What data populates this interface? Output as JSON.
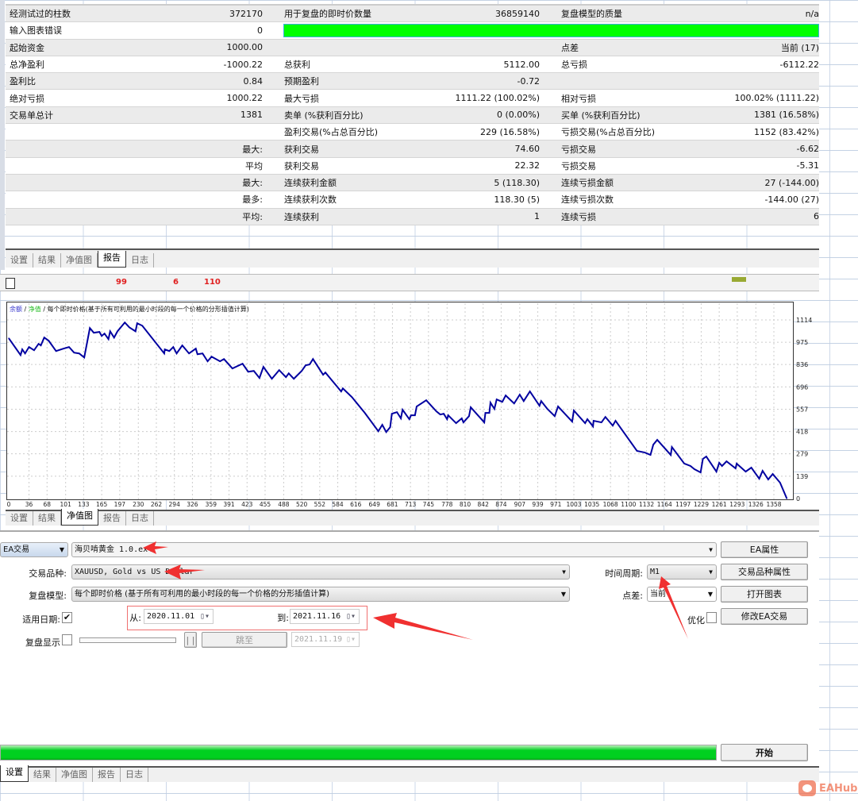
{
  "report": {
    "rows": [
      [
        "经测试过的柱数",
        "372170",
        "用于复盘的即时价数量",
        "36859140",
        "复盘模型的质量",
        "n/a"
      ],
      [
        "输入图表错误",
        "0",
        "",
        "",
        "",
        ""
      ],
      [
        "起始资金",
        "1000.00",
        "",
        "",
        "点差",
        "当前 (17)"
      ],
      [
        "总净盈利",
        "-1000.22",
        "总获利",
        "5112.00",
        "总亏损",
        "-6112.22"
      ],
      [
        "盈利比",
        "0.84",
        "预期盈利",
        "-0.72",
        "",
        ""
      ],
      [
        "绝对亏损",
        "1000.22",
        "最大亏损",
        "1111.22 (100.02%)",
        "相对亏损",
        "100.02% (1111.22)"
      ],
      [
        "交易单总计",
        "1381",
        "卖单 (%获利百分比)",
        "0 (0.00%)",
        "买单 (%获利百分比)",
        "1381 (16.58%)"
      ],
      [
        "",
        "",
        "盈利交易(%占总百分比)",
        "229 (16.58%)",
        "亏损交易(%占总百分比)",
        "1152 (83.42%)"
      ],
      [
        "",
        "最大:",
        "获利交易",
        "74.60",
        "亏损交易",
        "-6.62"
      ],
      [
        "",
        "平均",
        "获利交易",
        "22.32",
        "亏损交易",
        "-5.31"
      ],
      [
        "",
        "最大:",
        "连续获利金额",
        "5 (118.30)",
        "连续亏损金额",
        "27 (-144.00)"
      ],
      [
        "",
        "最多:",
        "连续获利次数",
        "118.30 (5)",
        "连续亏损次数",
        "-144.00 (27)"
      ],
      [
        "",
        "平均:",
        "连续获利",
        "1",
        "连续亏损",
        "6"
      ]
    ],
    "quality_bar_color": "#00ff00"
  },
  "tabs_top": {
    "items": [
      "设置",
      "结果",
      "净值图",
      "报告",
      "日志"
    ],
    "active": "报告"
  },
  "strip": {
    "badges": [
      "99",
      "6",
      "110"
    ]
  },
  "chart_data": {
    "type": "line",
    "legend": {
      "balance": "余额",
      "equity": "净值",
      "sep": "/"
    },
    "title": "每个即时价格(基于所有可利用的最小时段的每一个价格的分形插值计算)",
    "line_color": "#0000a0",
    "balance_color": "#3333cc",
    "equity_color": "#22bb22",
    "grid": true,
    "ylim": [
      0,
      1114
    ],
    "xlim": [
      0,
      1395
    ],
    "yticks": [
      1114,
      975,
      836,
      696,
      557,
      418,
      279,
      139,
      0
    ],
    "xticks": [
      0,
      36,
      68,
      101,
      133,
      165,
      197,
      230,
      262,
      294,
      326,
      359,
      391,
      423,
      455,
      488,
      520,
      552,
      584,
      616,
      649,
      681,
      713,
      745,
      778,
      810,
      842,
      874,
      907,
      939,
      971,
      1003,
      1035,
      1068,
      1100,
      1132,
      1164,
      1197,
      1229,
      1261,
      1293,
      1326,
      1358
    ],
    "series": [
      {
        "x": [
          0,
          21,
          24,
          29,
          36,
          45,
          53,
          57,
          63,
          71,
          84,
          97,
          107,
          116,
          125,
          134,
          144,
          151,
          161,
          165,
          170,
          177,
          180,
          187,
          193,
          206,
          214,
          225,
          228,
          237,
          276,
          277,
          285,
          292,
          298,
          308,
          320,
          332,
          335,
          344,
          353,
          360,
          375,
          382,
          397,
          415,
          425,
          435,
          445,
          452,
          467,
          480,
          492,
          497,
          506,
          520,
          527,
          534,
          540,
          558,
          562,
          590,
          593,
          609,
          632,
          656,
          663,
          670,
          677,
          680,
          689,
          696,
          699,
          711,
          714,
          721,
          724,
          741,
          759,
          766,
          772,
          778,
          780,
          794,
          804,
          807,
          817,
          820,
          844,
          846,
          853,
          855,
          862,
          866,
          876,
          882,
          897,
          907,
          914,
          925,
          942,
          945,
          956,
          969,
          975,
          1000,
          1003,
          1023,
          1027,
          1037,
          1038,
          1052,
          1059,
          1072,
          1077,
          1115,
          1129,
          1139,
          1144,
          1151,
          1175,
          1177,
          1199,
          1210,
          1217,
          1228,
          1232,
          1238,
          1256,
          1261,
          1266,
          1274,
          1290,
          1292,
          1308,
          1318,
          1332,
          1338,
          1348,
          1356,
          1369,
          1381
        ],
        "y": [
          1000,
          895,
          930,
          905,
          945,
          925,
          965,
          955,
          1004,
          984,
          920,
          935,
          945,
          910,
          905,
          880,
          1063,
          1034,
          1039,
          1014,
          1029,
          994,
          1043,
          1004,
          1043,
          1098,
          1068,
          1043,
          1093,
          1078,
          905,
          930,
          920,
          945,
          905,
          955,
          905,
          935,
          900,
          905,
          856,
          885,
          856,
          870,
          811,
          841,
          791,
          796,
          752,
          821,
          747,
          801,
          757,
          781,
          747,
          796,
          831,
          836,
          870,
          772,
          786,
          668,
          687,
          633,
          534,
          420,
          460,
          415,
          445,
          529,
          539,
          500,
          554,
          495,
          519,
          519,
          574,
          613,
          544,
          524,
          529,
          495,
          519,
          470,
          500,
          475,
          514,
          569,
          475,
          534,
          534,
          598,
          559,
          618,
          603,
          643,
          593,
          648,
          608,
          668,
          579,
          608,
          559,
          514,
          574,
          480,
          549,
          470,
          495,
          450,
          485,
          475,
          509,
          455,
          485,
          297,
          287,
          272,
          336,
          366,
          272,
          321,
          218,
          203,
          183,
          163,
          247,
          262,
          168,
          223,
          203,
          232,
          188,
          218,
          168,
          193,
          124,
          173,
          119,
          153,
          99,
          0
        ]
      }
    ]
  },
  "tabs_chart": {
    "items": [
      "设置",
      "结果",
      "净值图",
      "报告",
      "日志"
    ],
    "active": "净值图"
  },
  "settings": {
    "type_select": "EA交易",
    "ea_file": "海贝啃黄金 1.0.ex4",
    "symbol_label": "交易品种:",
    "symbol": "XAUUSD, Gold vs US Dollar",
    "model_label": "复盘模型:",
    "model": "每个即时价格 (基于所有可利用的最小时段的每一个价格的分形插值计算)",
    "period_label": "时间周期:",
    "period": "M1",
    "spread_label": "点差:",
    "spread": "当前",
    "use_date_label": "适用日期:",
    "use_date_checked": "✔",
    "from_label": "从:",
    "from": "2020.11.01",
    "to_label": "到:",
    "to": "2021.11.16",
    "optimize_label": "优化",
    "visual_label": "复盘显示",
    "pause": "| |",
    "skip_to": "跳至",
    "skip_date": "2021.11.19",
    "buttons": {
      "ea_props": "EA属性",
      "symbol_props": "交易品种属性",
      "open_chart": "打开图表",
      "modify_ea": "修改EA交易"
    },
    "start": "开始",
    "progress": 1.0,
    "progress_color": "#00d020",
    "annotation_color": "#f03030"
  },
  "tabs_bottom": {
    "items": [
      "设置",
      "结果",
      "净值图",
      "报告",
      "日志"
    ],
    "active": "设置"
  },
  "watermark": "EAHub"
}
